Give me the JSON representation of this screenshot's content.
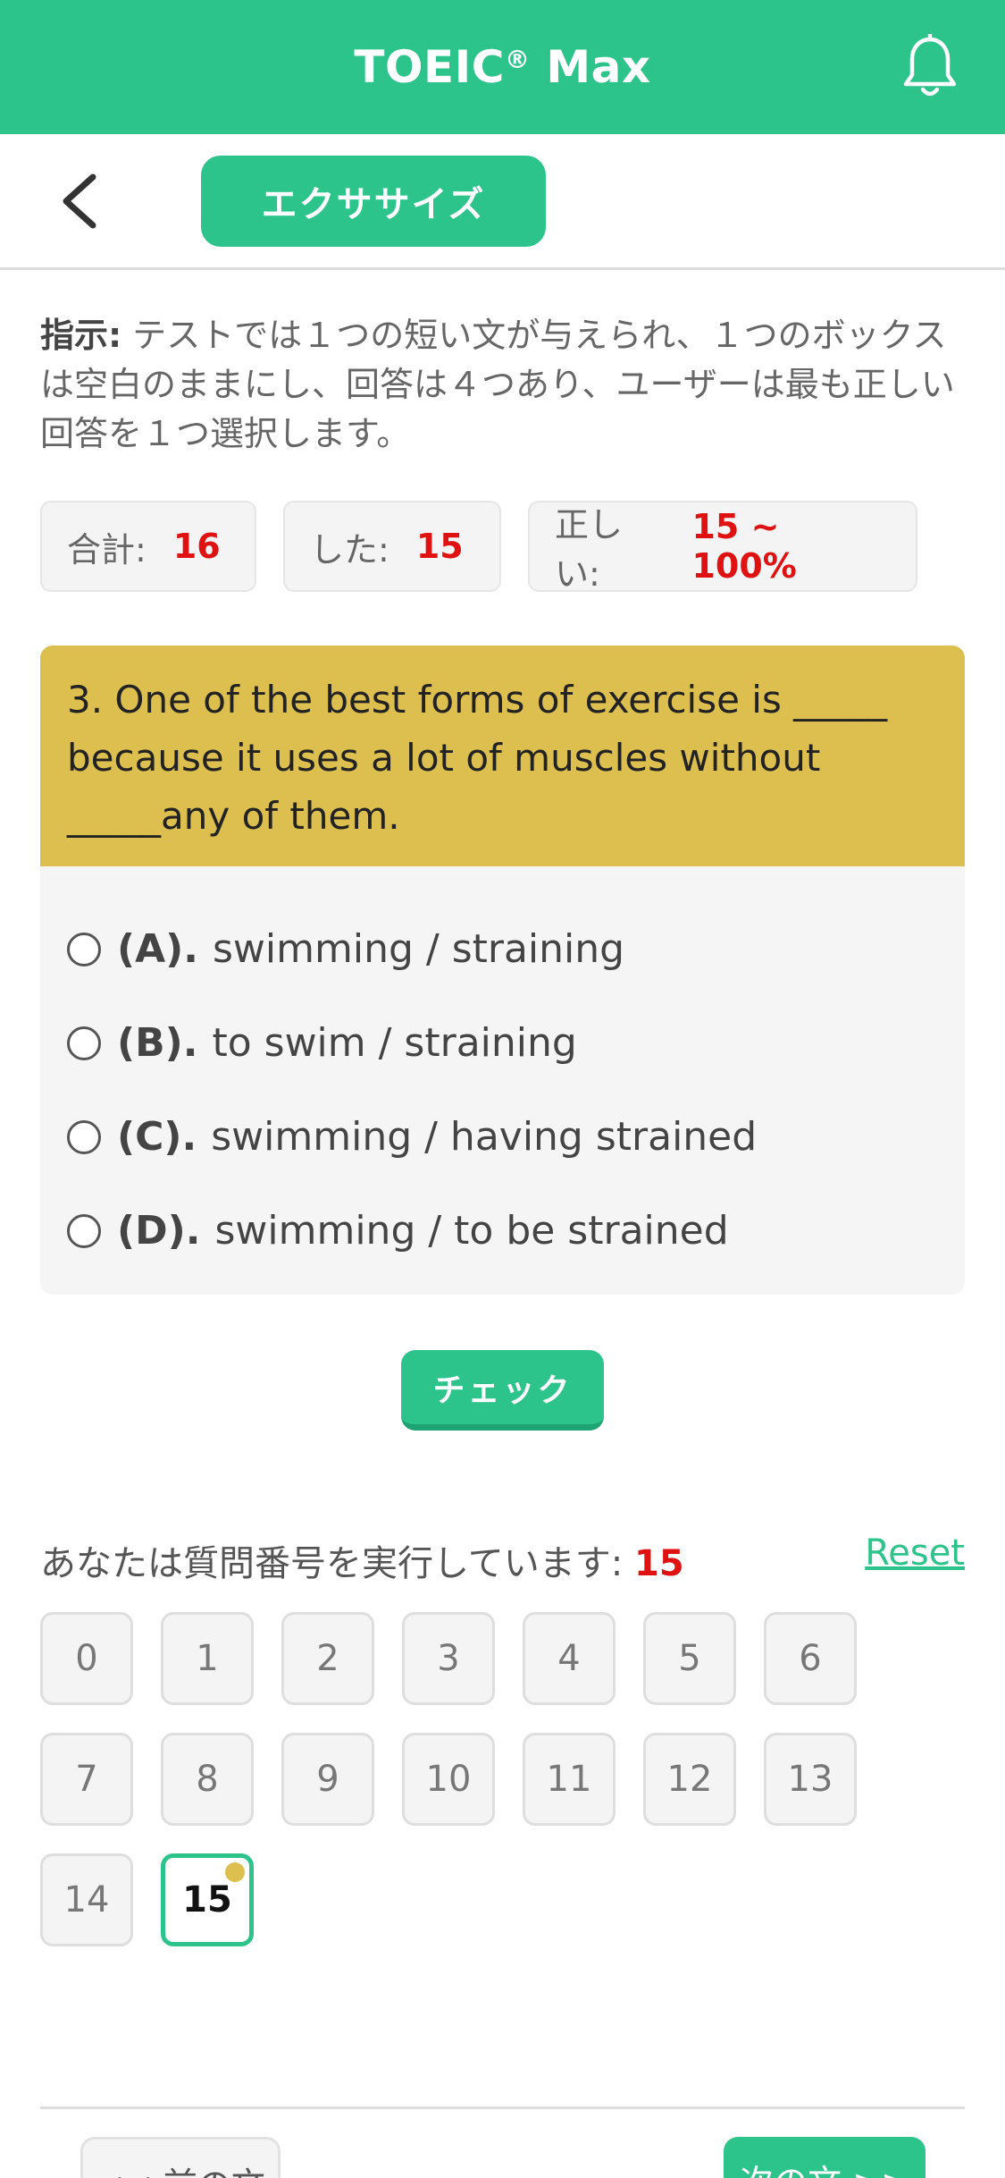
{
  "header": {
    "title": "TOEIC",
    "title_mark": "®",
    "title_suffix": "Max",
    "bell_icon": "bell-icon",
    "color": "#2dc48b"
  },
  "subbar": {
    "back_icon": "chevron-left-icon",
    "tab_label": "エクササイズ"
  },
  "instruction": {
    "label": "指示:",
    "text": "テストでは１つの短い文が与えられ、１つのボックスは空白のままにし、回答は４つあり、ユーザーは最も正しい回答を１つ選択します。"
  },
  "stats": {
    "total_label": "合計:",
    "total_value": "16",
    "done_label": "した:",
    "done_value": "15",
    "correct_label": "正しい:",
    "correct_value": "15 ~ 100%"
  },
  "question": {
    "text": "3. One of the best forms of exercise is _____ because it uses a lot of muscles without _____any of them.",
    "options": [
      {
        "letter": "(A).",
        "text": "swimming / straining"
      },
      {
        "letter": "(B).",
        "text": "to swim / straining"
      },
      {
        "letter": "(C).",
        "text": "swimming / having strained"
      },
      {
        "letter": "(D).",
        "text": "swimming / to be strained"
      }
    ],
    "card_color": "#dcbf4e"
  },
  "check_button": "チェック",
  "progress": {
    "label": "あなたは質問番号を実行しています:",
    "current": "15",
    "reset": "Reset"
  },
  "question_numbers": [
    "0",
    "1",
    "2",
    "3",
    "4",
    "5",
    "6",
    "7",
    "8",
    "9",
    "10",
    "11",
    "12",
    "13",
    "14",
    "15"
  ],
  "active_question": "15",
  "nav": {
    "prev": "<< 前の文",
    "next": "次の文 >>"
  }
}
